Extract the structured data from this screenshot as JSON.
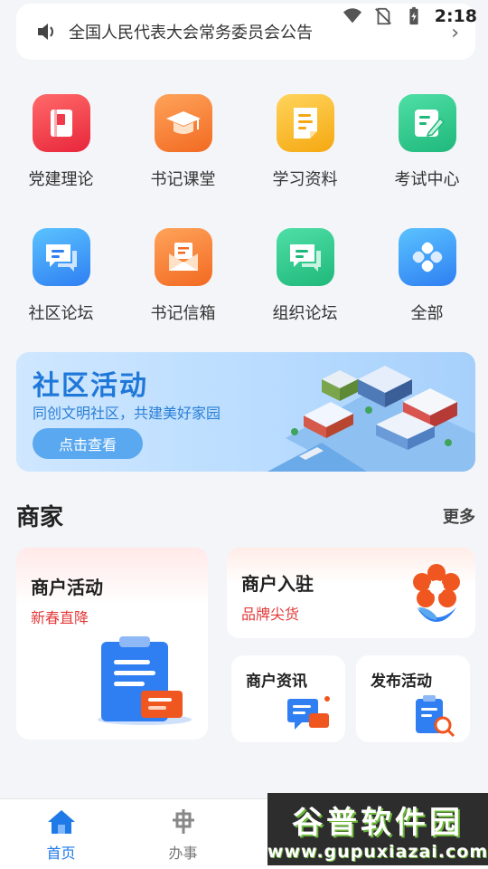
{
  "status_bar": {
    "time": "2:18"
  },
  "notice": {
    "text": "全国人民代表大会常务委员会公告"
  },
  "menu": [
    {
      "label": "党建理论",
      "icon": "book-icon"
    },
    {
      "label": "书记课堂",
      "icon": "graduation-cap-icon"
    },
    {
      "label": "学习资料",
      "icon": "document-icon"
    },
    {
      "label": "考试中心",
      "icon": "edit-note-icon"
    },
    {
      "label": "社区论坛",
      "icon": "chat-bubbles-icon"
    },
    {
      "label": "书记信箱",
      "icon": "mailbox-icon"
    },
    {
      "label": "组织论坛",
      "icon": "forum-icon"
    },
    {
      "label": "全部",
      "icon": "all-apps-icon"
    }
  ],
  "banner": {
    "title": "社区活动",
    "subtitle": "同创文明社区，共建美好家园",
    "button": "点击查看"
  },
  "merchants": {
    "title": "商家",
    "more": "更多",
    "activity": {
      "title": "商户活动",
      "subtitle": "新春直降"
    },
    "join": {
      "title": "商户入驻",
      "subtitle": "品牌尖货"
    },
    "news": {
      "title": "商户资讯"
    },
    "publish": {
      "title": "发布活动"
    }
  },
  "tabs": [
    {
      "label": "首页",
      "active": true
    },
    {
      "label": "办事",
      "active": false
    }
  ],
  "watermark": {
    "name": "谷普软件园",
    "url": "www.gupuxiazai.com"
  },
  "colors": {
    "accent": "#1f7ae8",
    "red": "#e43a3a"
  }
}
